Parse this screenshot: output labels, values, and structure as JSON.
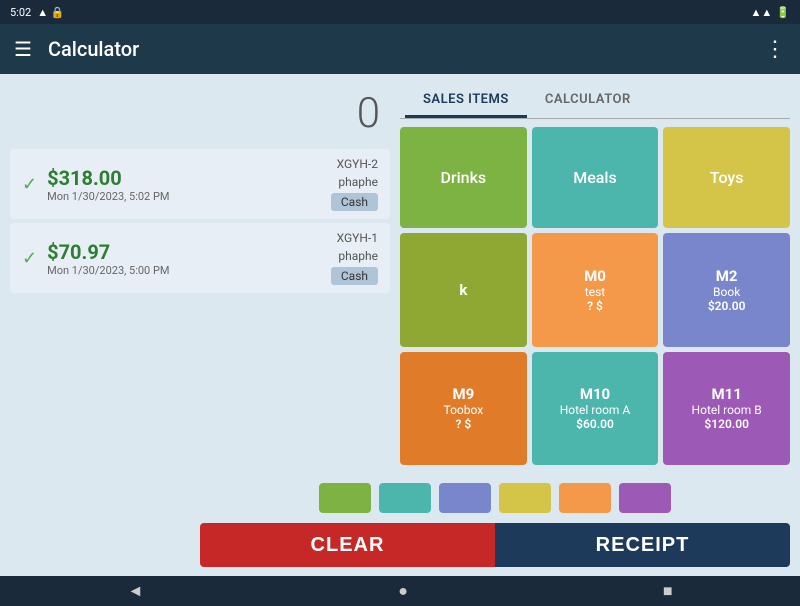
{
  "status_bar": {
    "time": "5:02",
    "icons": [
      "battery",
      "wifi",
      "signal"
    ]
  },
  "toolbar": {
    "title": "Calculator",
    "menu_icon": "☰",
    "more_icon": "⋮"
  },
  "display": {
    "number": "0"
  },
  "transactions": [
    {
      "amount": "$318.00",
      "date": "Mon 1/30/2023, 5:02 PM",
      "id": "XGYH-2",
      "user": "phaphe",
      "payment": "Cash"
    },
    {
      "amount": "$70.97",
      "date": "Mon 1/30/2023, 5:00 PM",
      "id": "XGYH-1",
      "user": "phaphe",
      "payment": "Cash"
    }
  ],
  "tabs": [
    {
      "label": "SALES ITEMS",
      "active": true
    },
    {
      "label": "CALCULATOR",
      "active": false
    }
  ],
  "categories": [
    {
      "label": "Drinks",
      "color": "color-green"
    },
    {
      "label": "Meals",
      "color": "color-teal"
    },
    {
      "label": "Toys",
      "color": "color-yellow"
    }
  ],
  "items": [
    {
      "code": "k",
      "name": "",
      "price": "",
      "color": "color-olive"
    },
    {
      "code": "M0",
      "name": "test",
      "price": "? $",
      "color": "color-orange"
    },
    {
      "code": "M2",
      "name": "Book",
      "price": "$20.00",
      "color": "color-blue-gray"
    },
    {
      "code": "M9",
      "name": "Toobox",
      "price": "? $",
      "color": "color-amber"
    },
    {
      "code": "M10",
      "name": "Hotel room A",
      "price": "$60.00",
      "color": "color-teal"
    },
    {
      "code": "M11",
      "name": "Hotel room B",
      "price": "$120.00",
      "color": "color-purple"
    }
  ],
  "palette": {
    "colors": [
      "#7cb342",
      "#4db6ac",
      "#7986cb",
      "#d4c447",
      "#f4994a",
      "#9c59b5"
    ]
  },
  "buttons": {
    "clear": "CLEAR",
    "receipt": "RECEIPT"
  },
  "nav": {
    "back": "◄",
    "home": "●",
    "recent": "■"
  }
}
